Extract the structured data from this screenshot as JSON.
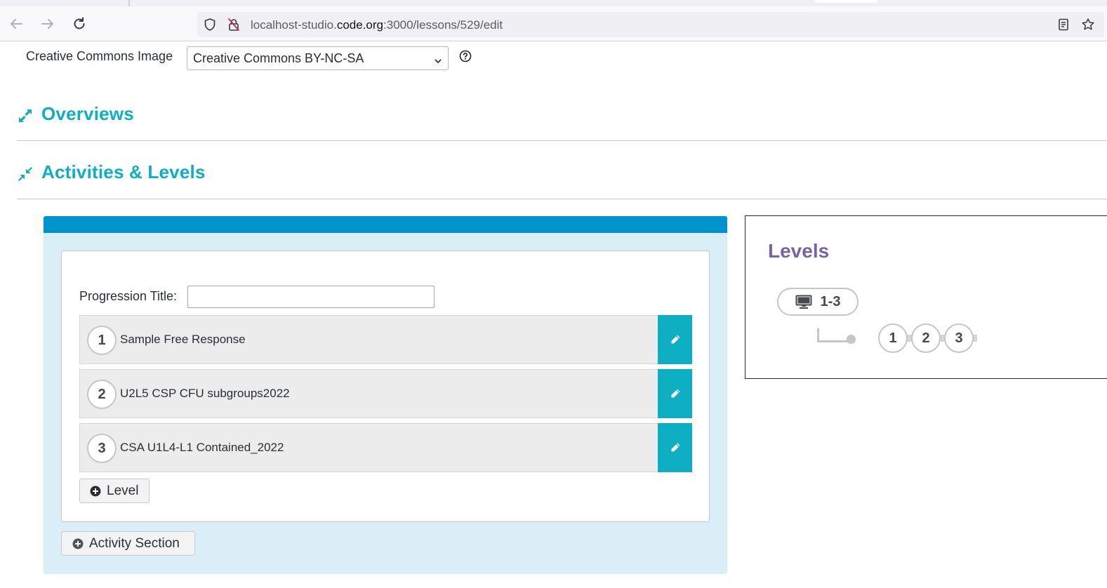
{
  "browser": {
    "url_prefix": "localhost-studio.",
    "url_host": "code.org",
    "url_path": ":3000/lessons/529/edit"
  },
  "creative_commons": {
    "label": "Creative Commons Image",
    "selected": "Creative Commons BY-NC-SA"
  },
  "sections": {
    "overviews": "Overviews",
    "activities": "Activities & Levels"
  },
  "activity": {
    "progression_label": "Progression Title:",
    "progression_value": "",
    "levels": [
      {
        "number": "1",
        "name": "Sample Free Response"
      },
      {
        "number": "2",
        "name": "U2L5 CSP CFU subgroups2022"
      },
      {
        "number": "3",
        "name": "CSA U1L4-L1 Contained_2022"
      }
    ],
    "add_level_label": "Level",
    "add_section_label": "Activity Section"
  },
  "levels_preview": {
    "title": "Levels",
    "group_label": "1-3",
    "bubbles": [
      "1",
      "2",
      "3"
    ]
  },
  "colors": {
    "teal": "#0eaec3",
    "blue_bar": "#0093cb",
    "panel_bg": "#d9eef6",
    "purple": "#7665a0"
  }
}
